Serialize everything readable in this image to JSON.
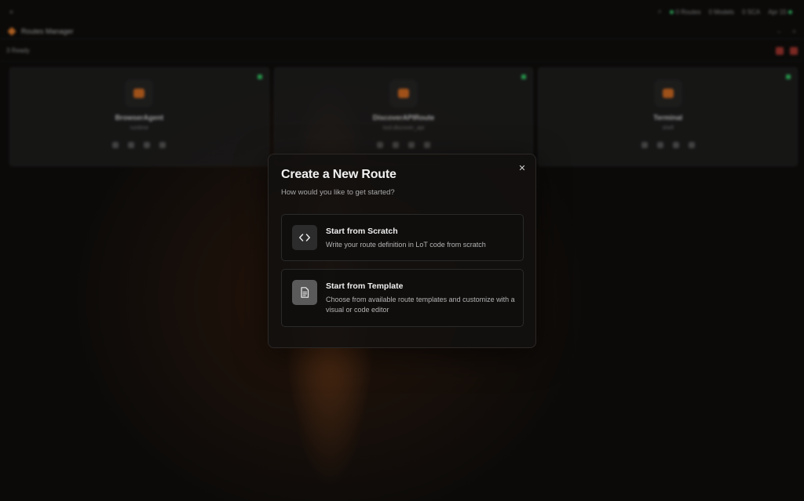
{
  "topbar": {
    "status_items": [
      "0 Routes",
      "0 Models",
      "0 SCA",
      "Apr 15"
    ]
  },
  "titlebar": {
    "app_name": "Routes Manager"
  },
  "toolbar": {
    "count_label": "3 Ready"
  },
  "cards": [
    {
      "name": "BrowserAgent",
      "sub": "runtime"
    },
    {
      "name": "DiscoverAPIRoute",
      "sub": "tool.discover_api"
    },
    {
      "name": "Terminal",
      "sub": "shell"
    }
  ],
  "modal": {
    "title": "Create a New Route",
    "subtitle": "How would you like to get started?",
    "options": [
      {
        "title": "Start from Scratch",
        "description": "Write your route definition in LoT code from scratch",
        "icon": "code-icon"
      },
      {
        "title": "Start from Template",
        "description": "Choose from available route templates and customize with a visual or code editor",
        "icon": "document-icon"
      }
    ]
  },
  "colors": {
    "accent": "#e07a2a",
    "status_ok": "#2fbf5e",
    "danger": "#a1332c"
  }
}
